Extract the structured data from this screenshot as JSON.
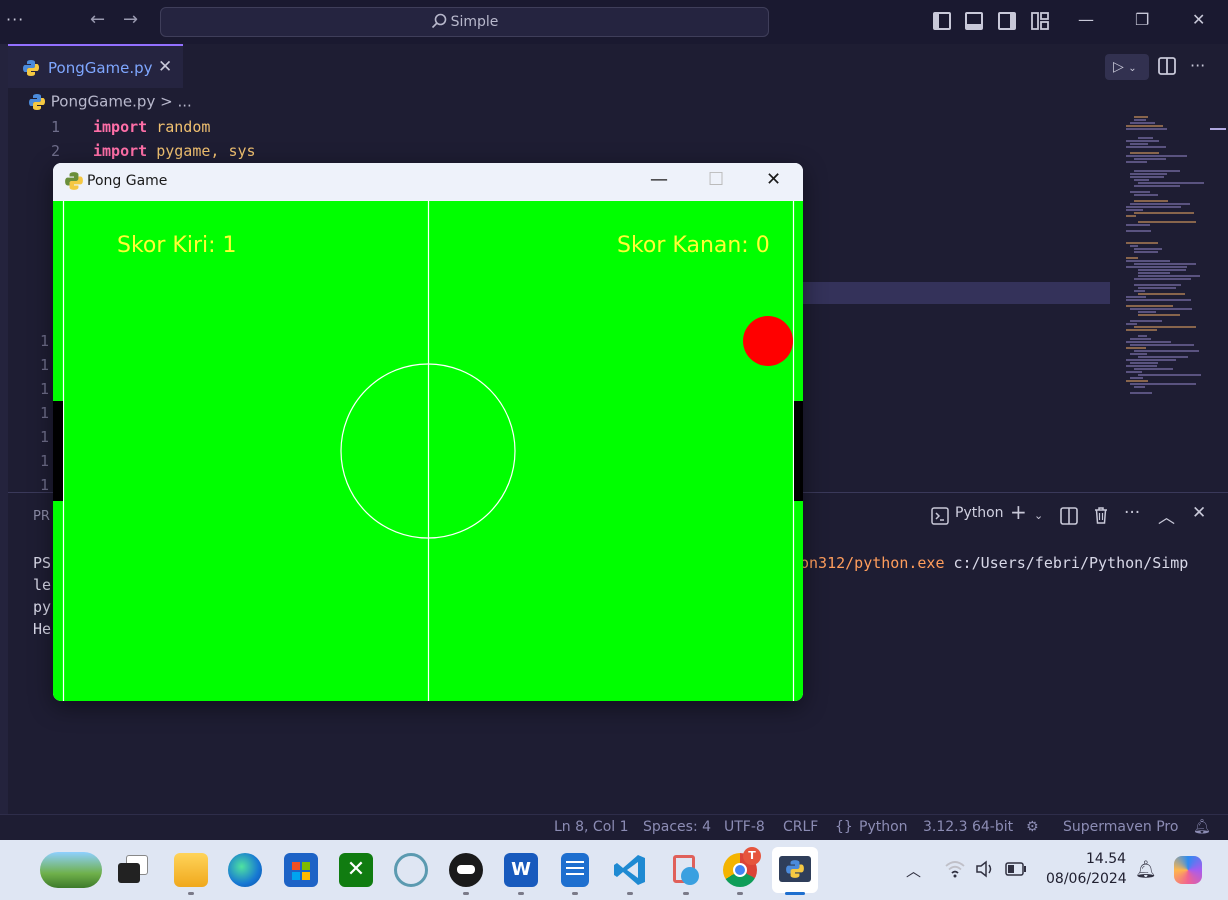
{
  "titlebar": {
    "search_text": "Simple",
    "menu_dots": "···",
    "back": "←",
    "forward": "→",
    "minimize": "—",
    "restore": "❐",
    "close": "✕"
  },
  "tab": {
    "filename": "PongGame.py",
    "close": "✕"
  },
  "breadcrumb": {
    "file": "PongGame.py",
    "sep": ">",
    "rest": "..."
  },
  "editor": {
    "lines": [
      {
        "num": "1",
        "kw": "import",
        "rest": " random"
      },
      {
        "num": "2",
        "kw": "import",
        "rest": " pygame, sys"
      }
    ],
    "partial_line_numbers": [
      "1",
      "1",
      "1",
      "1",
      "1",
      "1",
      "1"
    ]
  },
  "panel": {
    "title_fragment": "PR",
    "terminal_name": "Python",
    "lines_left": [
      "PS",
      "le",
      "py",
      "He"
    ],
    "command_path": "on312/python.exe",
    "command_rest": " c:/Users/febri/Python/Simp"
  },
  "statusbar": {
    "position": "Ln 8, Col 1",
    "spaces": "Spaces: 4",
    "encoding": "UTF-8",
    "eol": "CRLF",
    "language": "Python",
    "interpreter": "3.12.3 64-bit",
    "extension": "Supermaven Pro"
  },
  "pong": {
    "window_title": "Pong Game",
    "score_left_text": "Skor Kiri: 1",
    "score_right_text": "Skor Kanan: 0",
    "colors": {
      "field": "#00ff00",
      "score": "#ffff33",
      "ball": "#ff0000",
      "paddle": "#000000",
      "lines": "#ffffff"
    }
  },
  "taskbar": {
    "time": "14.54",
    "date": "08/06/2024",
    "apps": [
      "widgets-icon",
      "task-view-icon",
      "file-explorer-icon",
      "edge-icon",
      "store-icon",
      "xbox-icon",
      "cortana-icon",
      "chat-bot-icon",
      "word-icon",
      "notepad-icon",
      "vscode-icon",
      "snipping-tool-icon",
      "chrome-icon",
      "python-app-icon"
    ],
    "chrome_badge": "T"
  }
}
